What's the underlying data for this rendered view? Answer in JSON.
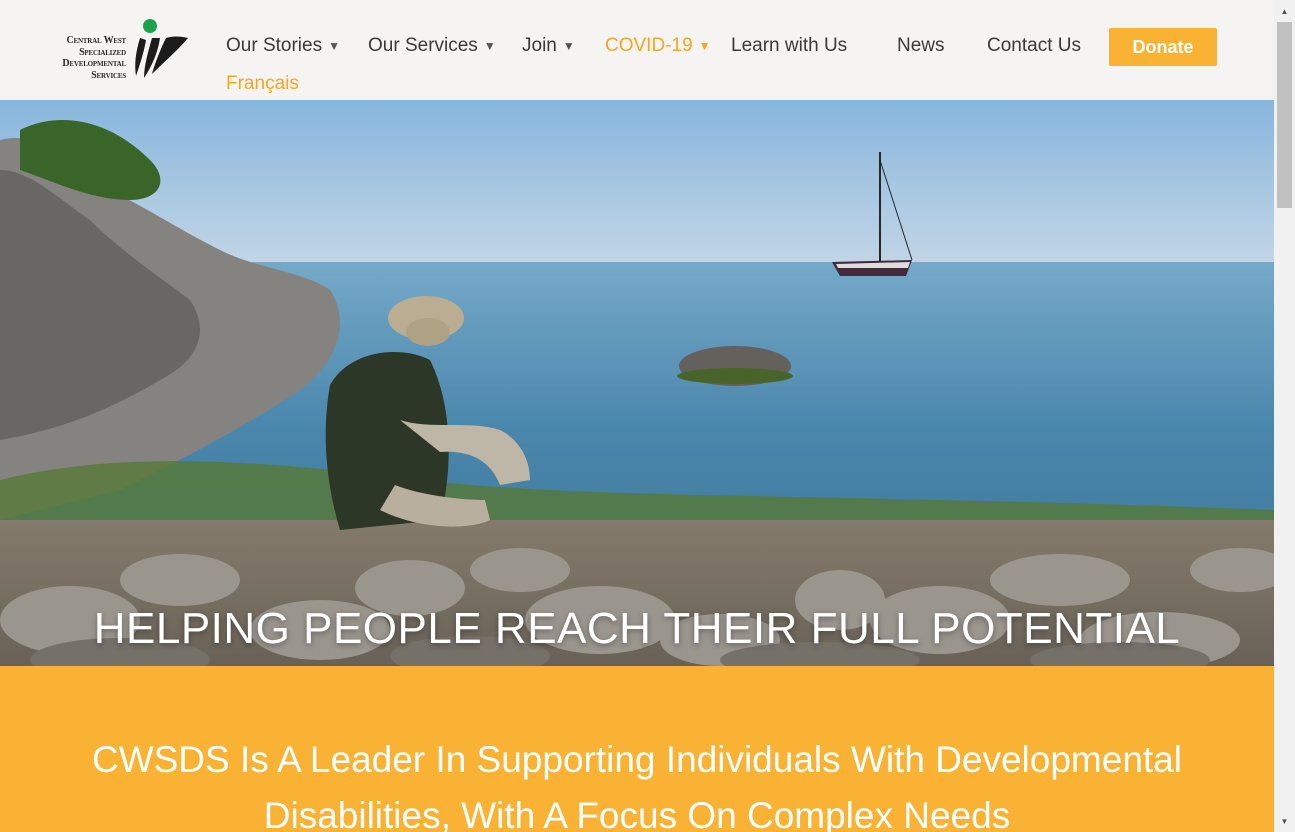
{
  "logo": {
    "lines": [
      "Central West",
      "Specialized",
      "Developmental",
      "Services"
    ]
  },
  "nav": {
    "items": [
      {
        "label": "Our Stories",
        "has_dropdown": true
      },
      {
        "label": "Our Services",
        "has_dropdown": true
      },
      {
        "label": "Join",
        "has_dropdown": true
      },
      {
        "label": "COVID-19",
        "has_dropdown": true,
        "active": true
      },
      {
        "label": "Learn with Us",
        "has_dropdown": false
      },
      {
        "label": "News",
        "has_dropdown": false
      },
      {
        "label": "Contact Us",
        "has_dropdown": false
      }
    ],
    "donate_label": "Donate",
    "language_label": "Français"
  },
  "hero": {
    "title": "HELPING PEOPLE REACH THEIR FULL POTENTIAL"
  },
  "band": {
    "title": "CWSDS Is A Leader In Supporting Individuals With Developmental Disabilities, With A Focus On Complex Needs"
  },
  "colors": {
    "accent": "#f9b233",
    "active_nav": "#f5a623",
    "header_bg": "#f5f4f2",
    "logo_green": "#1aa34a"
  },
  "icons": {
    "caret": "caret-down-icon",
    "scroll_up": "scroll-up-arrow-icon",
    "scroll_down": "scroll-down-arrow-icon"
  }
}
